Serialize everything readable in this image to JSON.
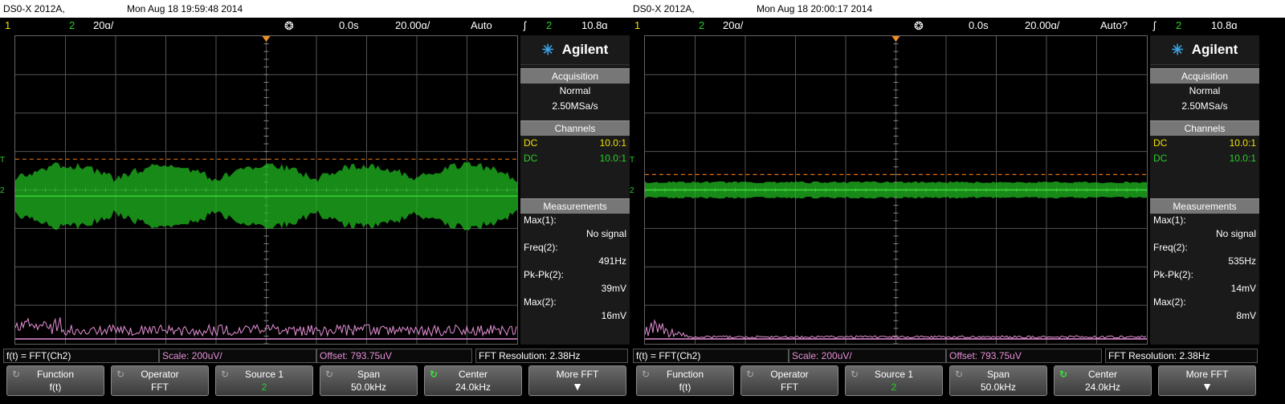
{
  "scopes": [
    {
      "header": {
        "model": "DS0-X 2012A,",
        "datetime": "Mon Aug 18 19:59:48 2014"
      },
      "status": {
        "ch1_num": "1",
        "ch2_num": "2",
        "ch2_scale": "20ɑ/",
        "trig_icon": "trigger-marker-icon",
        "time_pos": "0.0s",
        "time_scale": "20.00ɑ/",
        "mode": "Auto",
        "trig_sym": "ʃ",
        "trig_ch": "2",
        "trig_level": "10.8ɑ"
      },
      "markers": {
        "trig": "T",
        "ch": "2"
      },
      "panel": {
        "logo": "Agilent",
        "acquisition_title": "Acquisition",
        "acq_mode": "Normal",
        "acq_rate": "2.50MSa/s",
        "channels_title": "Channels",
        "channels": [
          {
            "coupling": "DC",
            "probe": "10.0:1",
            "color": "#f0e000"
          },
          {
            "coupling": "DC",
            "probe": "10.0:1",
            "color": "#28d028"
          }
        ],
        "measurements_title": "Measurements",
        "measurements": [
          {
            "label": "Max(1):",
            "value": "No signal"
          },
          {
            "label": "Freq(2):",
            "value": "491Hz"
          },
          {
            "label": "Pk-Pk(2):",
            "value": "39mV"
          },
          {
            "label": "Max(2):",
            "value": "16mV"
          }
        ]
      },
      "fft": {
        "func": "f(t) = FFT(Ch2)",
        "scale": "Scale: 200uV/",
        "offset": "Offset: 793.75uV",
        "resolution": "FFT Resolution: 2.38Hz"
      },
      "softkeys": [
        {
          "label": "Function",
          "value": "f(t)"
        },
        {
          "label": "Operator",
          "value": "FFT"
        },
        {
          "label": "Source 1",
          "value": "2"
        },
        {
          "label": "Span",
          "value": "50.0kHz"
        },
        {
          "label": "Center",
          "value": "24.0kHz"
        },
        {
          "label": "More FFT",
          "value": ""
        }
      ],
      "trace": {
        "center_frac": 0.52,
        "half_band_frac": 0.1,
        "trig_line_frac": 0.4,
        "ripple": true
      }
    },
    {
      "header": {
        "model": "DS0-X 2012A,",
        "datetime": "Mon Aug 18 20:00:17 2014"
      },
      "status": {
        "ch1_num": "1",
        "ch2_num": "2",
        "ch2_scale": "20ɑ/",
        "trig_icon": "trigger-marker-icon",
        "time_pos": "0.0s",
        "time_scale": "20.00ɑ/",
        "mode": "Auto?",
        "trig_sym": "ʃ",
        "trig_ch": "2",
        "trig_level": "10.8ɑ"
      },
      "markers": {
        "trig": "T",
        "ch": "2"
      },
      "panel": {
        "logo": "Agilent",
        "acquisition_title": "Acquisition",
        "acq_mode": "Normal",
        "acq_rate": "2.50MSa/s",
        "channels_title": "Channels",
        "channels": [
          {
            "coupling": "DC",
            "probe": "10.0:1",
            "color": "#f0e000"
          },
          {
            "coupling": "DC",
            "probe": "10.0:1",
            "color": "#28d028"
          }
        ],
        "measurements_title": "Measurements",
        "measurements": [
          {
            "label": "Max(1):",
            "value": "No signal"
          },
          {
            "label": "Freq(2):",
            "value": "535Hz"
          },
          {
            "label": "Pk-Pk(2):",
            "value": "14mV"
          },
          {
            "label": "Max(2):",
            "value": "8mV"
          }
        ]
      },
      "fft": {
        "func": "f(t) = FFT(Ch2)",
        "scale": "Scale: 200uV/",
        "offset": "Offset: 793.75uV",
        "resolution": "FFT Resolution: 2.38Hz"
      },
      "softkeys": [
        {
          "label": "Function",
          "value": "f(t)"
        },
        {
          "label": "Operator",
          "value": "FFT"
        },
        {
          "label": "Source 1",
          "value": "2"
        },
        {
          "label": "Span",
          "value": "50.0kHz"
        },
        {
          "label": "Center",
          "value": "24.0kHz"
        },
        {
          "label": "More FFT",
          "value": ""
        }
      ],
      "trace": {
        "center_frac": 0.5,
        "half_band_frac": 0.025,
        "trig_line_frac": 0.45,
        "ripple": false
      }
    }
  ]
}
